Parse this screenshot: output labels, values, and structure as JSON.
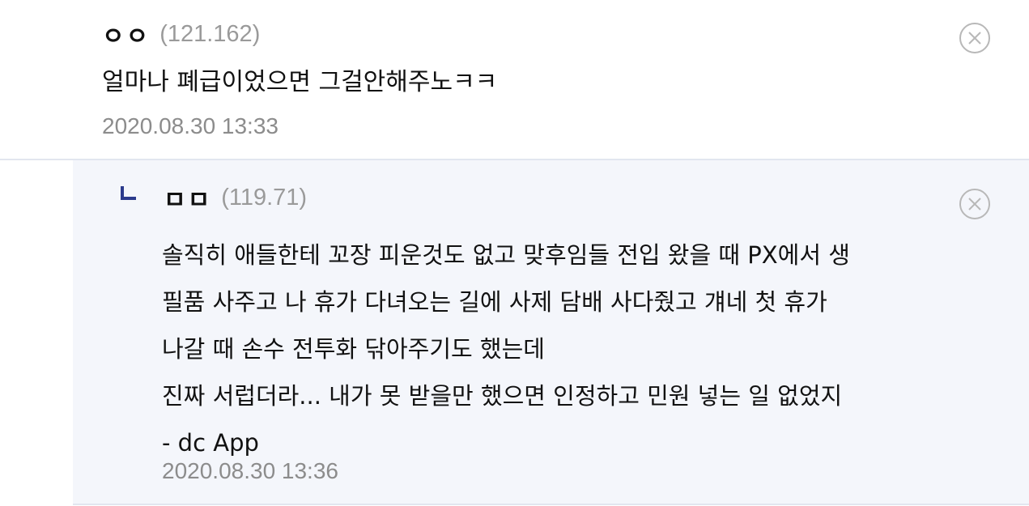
{
  "comments": [
    {
      "nickname": "ㅇㅇ",
      "ip": "(121.162)",
      "text": "얼마나 폐급이었으면 그걸안해주노ㅋㅋ",
      "date": "2020.08.30 13:33",
      "delete_icon": "circle-x-icon"
    }
  ],
  "replies": [
    {
      "reply_marker_icon": "reply-arrow-icon",
      "nickname": "ㅁㅁ",
      "ip": "(119.71)",
      "lines": [
        "솔직히 애들한테 꼬장 피운것도 없고 맞후임들 전입 왔을 때 PX에서 생",
        "필품 사주고 나 휴가 다녀오는 길에 사제 담배 사다줬고 걔네 첫 휴가",
        "나갈 때 손수 전투화 닦아주기도 했는데",
        "진짜 서럽더라... 내가 못 받을만 했으면 인정하고 민원 넣는 일 없었지",
        "- dc App"
      ],
      "date": "2020.08.30 13:36",
      "delete_icon": "circle-x-icon"
    }
  ],
  "colors": {
    "reply_background": "#f4f6fb",
    "divider": "#e2e6ef",
    "reply_marker": "#2b3a8c",
    "muted_text": "#8c8c8c"
  }
}
